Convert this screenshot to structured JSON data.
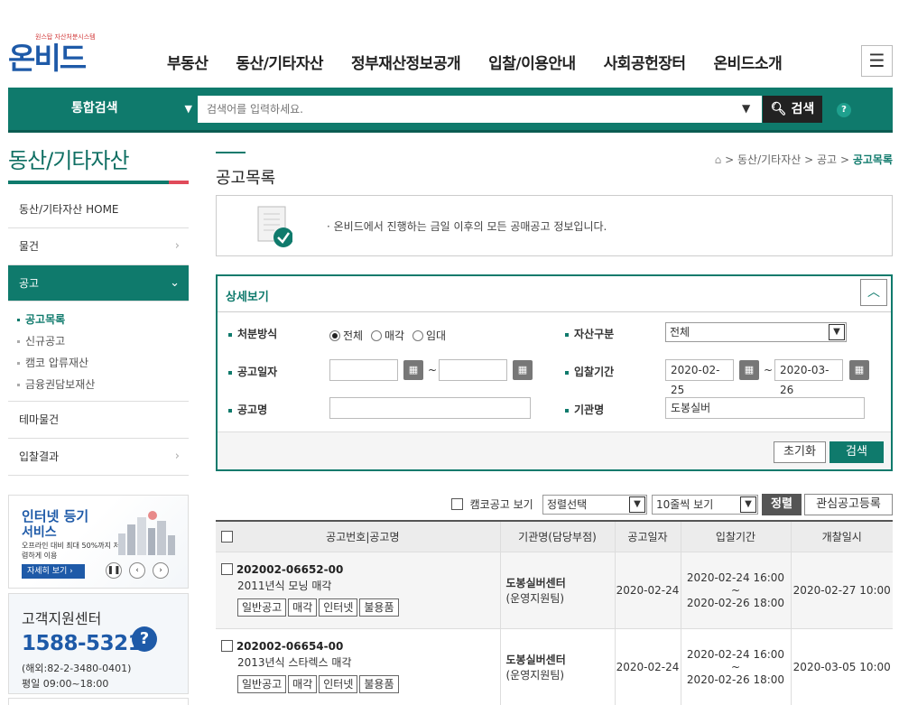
{
  "header": {
    "logo_tag": "원스탑 자산처분시스템",
    "logo_text": "온비드",
    "nav": [
      "부동산",
      "동산/기타자산",
      "정부재산정보공개",
      "입찰/이용안내",
      "사회공헌장터",
      "온비드소개"
    ],
    "menu_icon": "hamburger-icon"
  },
  "search": {
    "category": "통합검색",
    "placeholder": "검색어를 입력하세요.",
    "button": "검색",
    "help": "?"
  },
  "sidebar": {
    "title": "동산/기타자산",
    "items": [
      {
        "label": "동산/기타자산 HOME"
      },
      {
        "label": "물건"
      },
      {
        "label": "공고"
      }
    ],
    "sub": [
      "공고목록",
      "신규공고",
      "캠코 압류재산",
      "금융권담보재산"
    ],
    "items2": [
      {
        "label": "테마물건"
      },
      {
        "label": "입찰결과"
      }
    ]
  },
  "banner1": {
    "line1": "인터넷 등기",
    "line2": "서비스",
    "line3": "오프라인 대비 최대 50%까지 저렴하게 이용",
    "more": "자세히 보기 ›"
  },
  "banner2": {
    "title": "고객지원센터",
    "phone": "1588-5321",
    "overseas": "(해외:82-2-3480-0401)",
    "hours": "평일 09:00~18:00"
  },
  "page": {
    "title": "공고목록",
    "breadcrumb": [
      ">",
      "동산/기타자산",
      ">",
      "공고",
      ">"
    ],
    "breadcrumb_current": "공고목록",
    "notice": "· 온비드에서 진행하는 금일 이후의 모든 공매공고 정보입니다."
  },
  "detail": {
    "title": "상세보기",
    "labels": {
      "method": "처분방식",
      "asset_type": "자산구분",
      "notice_date": "공고일자",
      "bid_period": "입찰기간",
      "notice_name": "공고명",
      "agency": "기관명"
    },
    "method_options": [
      "전체",
      "매각",
      "임대"
    ],
    "method_selected": "전체",
    "asset_type_value": "전체",
    "notice_date_from": "",
    "notice_date_to": "",
    "bid_from": "2020-02-25",
    "bid_to": "2020-03-26",
    "notice_name_value": "",
    "agency_value": "도봉실버",
    "reset": "초기화",
    "search": "검색"
  },
  "toolbar": {
    "kamco_label": "캠코공고 보기",
    "sort_value": "정렬선택",
    "rows_value": "10줄씩 보기",
    "sort_button": "정렬",
    "fav_button": "관심공고등록"
  },
  "table": {
    "headers": [
      "공고번호|공고명",
      "기관명(담당부점)",
      "공고일자",
      "입찰기간",
      "개찰일시"
    ],
    "rows": [
      {
        "no": "202002-06652-00",
        "name": "2011년식 모닝 매각",
        "tags": [
          "일반공고",
          "매각",
          "인터넷",
          "불용품"
        ],
        "agency": "도봉실버센터",
        "dept": "(운영지원팀)",
        "date": "2020-02-24",
        "bid_start": "2020-02-24 16:00 ~",
        "bid_end": "2020-02-26 18:00",
        "open": "2020-02-27 10:00"
      },
      {
        "no": "202002-06654-00",
        "name": "2013년식 스타렉스 매각",
        "tags": [
          "일반공고",
          "매각",
          "인터넷",
          "불용품"
        ],
        "agency": "도봉실버센터",
        "dept": "(운영지원팀)",
        "date": "2020-02-24",
        "bid_start": "2020-02-24 16:00 ~",
        "bid_end": "2020-02-26 18:00",
        "open": "2020-03-05 10:00"
      }
    ]
  },
  "colors": {
    "primary": "#0f7a6c",
    "brand_blue": "#1e5aa8",
    "accent_red": "#e04b5a"
  }
}
